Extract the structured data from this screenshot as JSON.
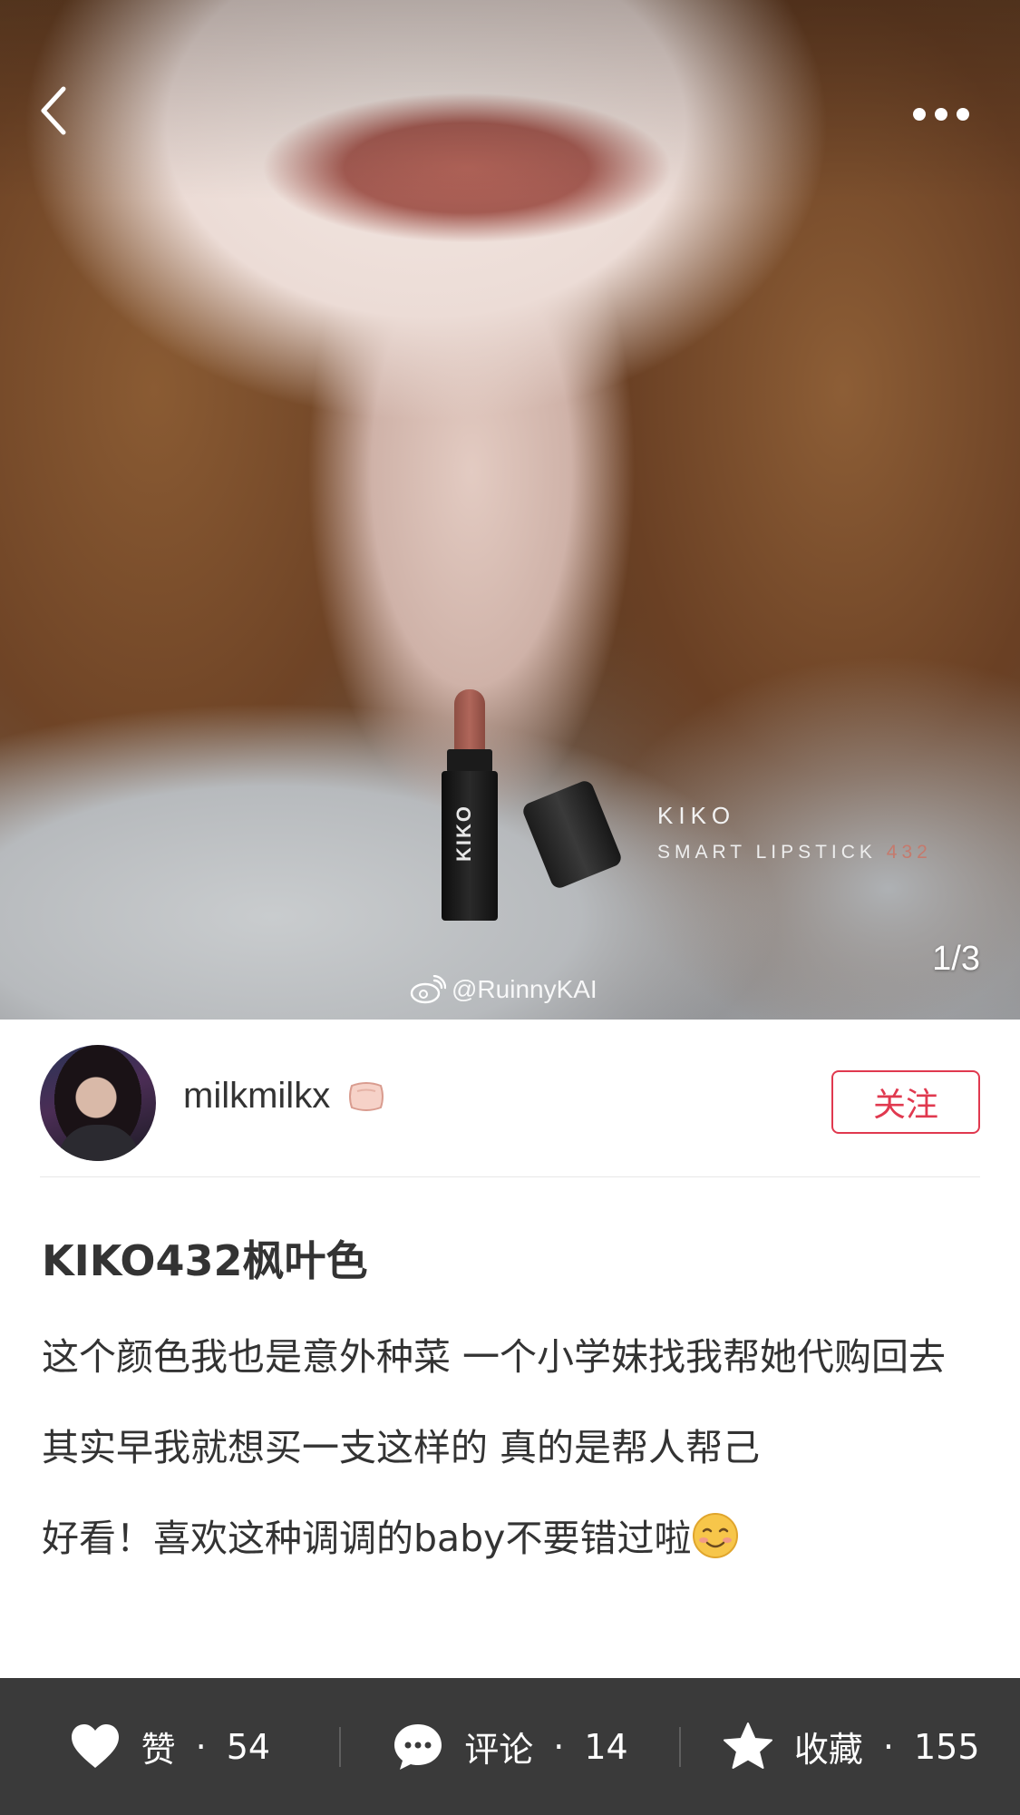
{
  "header": {
    "back_icon": "chevron-left-icon",
    "more_icon": "more-dots-icon",
    "page_indicator": "1/3"
  },
  "image": {
    "product_brand": "KIKO",
    "product_name": "SMART LIPSTICK",
    "product_shade": "432",
    "watermark": "@RuinnyKAI",
    "watermark_icon": "weibo-icon"
  },
  "author": {
    "username": "milkmilkx",
    "badge_icon": "pillow-emoji-icon",
    "follow_label": "关注"
  },
  "note": {
    "title": "KIKO432枫叶色",
    "paragraphs": [
      "这个颜色我也是意外种菜 一个小学妹找我帮她代购回去",
      "其实早我就想买一支这样的 真的是帮人帮己",
      "好看！喜欢这种调调的baby不要错过啦"
    ],
    "emoji_icon": "smiling-face-icon"
  },
  "actions": {
    "like": {
      "label": "赞",
      "separator": "·",
      "count": "54",
      "icon": "heart-icon"
    },
    "comment": {
      "label": "评论",
      "separator": "·",
      "count": "14",
      "icon": "comment-bubble-icon"
    },
    "collect": {
      "label": "收藏",
      "separator": "·",
      "count": "155",
      "icon": "star-icon"
    }
  },
  "colors": {
    "accent": "#e0394f",
    "action_bar": "#3a3a3a",
    "text": "#333333"
  }
}
